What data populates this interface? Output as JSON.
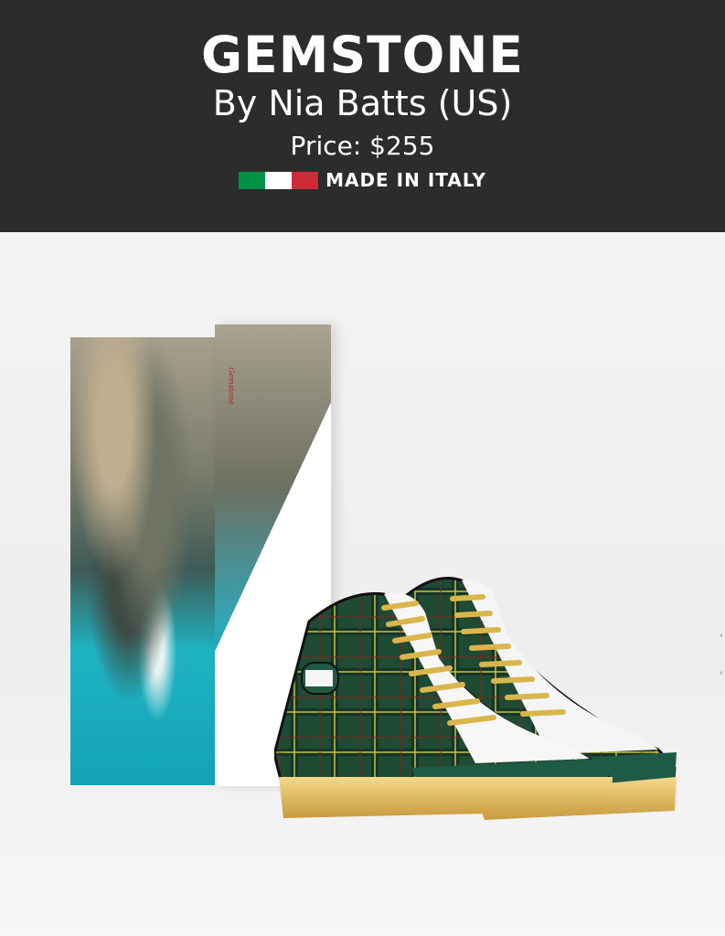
{
  "header": {
    "title": "GEMSTONE",
    "byline": "By Nia Batts (US)",
    "price": "Price: $255",
    "made_in": "MADE IN ITALY",
    "flag_colors": [
      "#009246",
      "#ffffff",
      "#ce2b37"
    ],
    "background": "#2c2c2c"
  },
  "product": {
    "box_label": "Gemstone",
    "shoe_label": "Gemstone",
    "icons": [
      "chevron-left-icon",
      "chevron-left-icon"
    ]
  }
}
